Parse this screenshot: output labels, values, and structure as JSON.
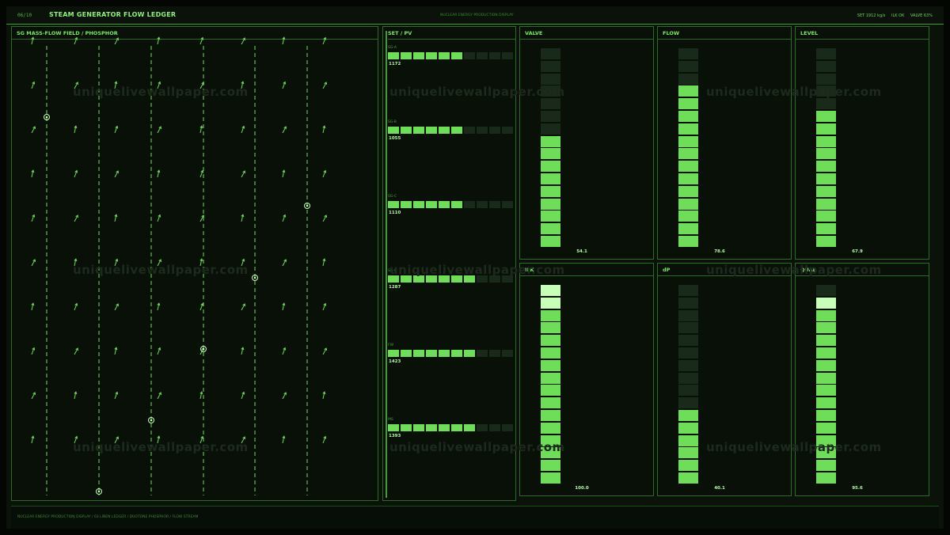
{
  "topbar": {
    "page": "06/10",
    "title": "STEAM GENERATOR FLOW LEDGER",
    "subtitle": "NUCLEAR ENERGY PRODUCTION DISPLAY",
    "status": [
      "SET 1912 kg/s",
      "ILK OK",
      "VALVE 63%"
    ]
  },
  "field": {
    "title": "SG MASS-FLOW FIELD / PHOSPHOR"
  },
  "setpv": {
    "title": "SET / PV",
    "rows": [
      {
        "label": "SG-A",
        "value": "1172",
        "lit": 6
      },
      {
        "label": "SG-B",
        "value": "1055",
        "lit": 6
      },
      {
        "label": "SG-C",
        "value": "1110",
        "lit": 6
      },
      {
        "label": "SG-D",
        "value": "1287",
        "lit": 7
      },
      {
        "label": "FW",
        "value": "1423",
        "lit": 7
      },
      {
        "label": "MS",
        "value": "1393",
        "lit": 7
      }
    ]
  },
  "meters": [
    {
      "title": "VALVE",
      "value": "54.1",
      "level": 0.541,
      "segments": 16
    },
    {
      "title": "FLOW",
      "value": "78.6",
      "level": 0.786,
      "segments": 16
    },
    {
      "title": "LEVEL",
      "value": "67.9",
      "level": 0.679,
      "segments": 16
    },
    {
      "title": "ILK",
      "value": "100.0",
      "level": 1.0,
      "segments": 16
    },
    {
      "title": "dP",
      "value": "40.1",
      "level": 0.401,
      "segments": 16
    },
    {
      "title": "QUAL",
      "value": "95.6",
      "level": 0.956,
      "segments": 16
    }
  ],
  "footer": {
    "text": "NUCLEAR ENERGY PRODUCTION DISPLAY / 03 LINEN LEDGER / DUOTONE PHOSPHOR / FLOW STREAM"
  },
  "watermark": "uniquelivewallpaper.com",
  "colors": {
    "accent": "#6fdc5a",
    "bright": "#c8ffb8",
    "dim": "#1a2a1a",
    "border": "#2e6b29"
  }
}
